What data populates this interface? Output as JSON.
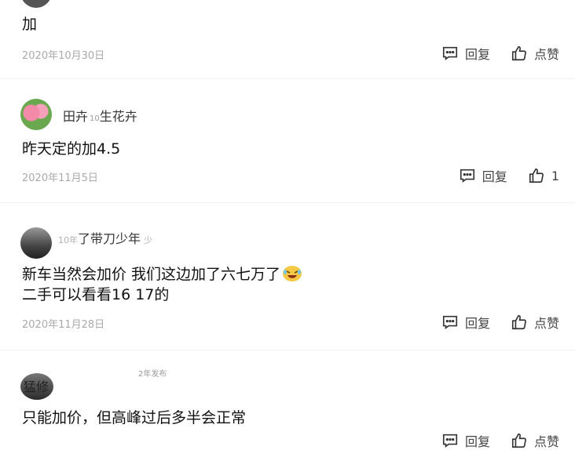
{
  "comments": [
    {
      "text_lines": [
        "加"
      ],
      "date": "2020年10月30日",
      "reply_label": "回复",
      "like_label": "点赞"
    },
    {
      "name": "田卉",
      "name_suffix": "10",
      "name_extra": "生花卉",
      "text_lines": [
        "昨天定的加4.5"
      ],
      "date": "2020年11月5日",
      "reply_label": "回复",
      "like_label": "1"
    },
    {
      "name_prefix": "10年",
      "name": "了带刀少年",
      "name_extra": "少",
      "text_lines": [
        "新车当然会加价 我们这边加了六七万了",
        "二手可以看看16 17的"
      ],
      "date": "2020年11月28日",
      "reply_label": "回复",
      "like_label": "点赞"
    },
    {
      "name": "猛修",
      "name_extra": "2年发布",
      "text_lines": [
        "只能加价，但高峰过后多半会正常"
      ],
      "date": "",
      "reply_label": "回复",
      "like_label": "点赞"
    }
  ],
  "icons": {
    "reply": "reply-comment-icon",
    "like": "thumbs-up-icon",
    "emoji": "laughing-emoji-icon"
  },
  "colors": {
    "text": "#111111",
    "meta": "#a9a9a9",
    "action": "#444444"
  }
}
